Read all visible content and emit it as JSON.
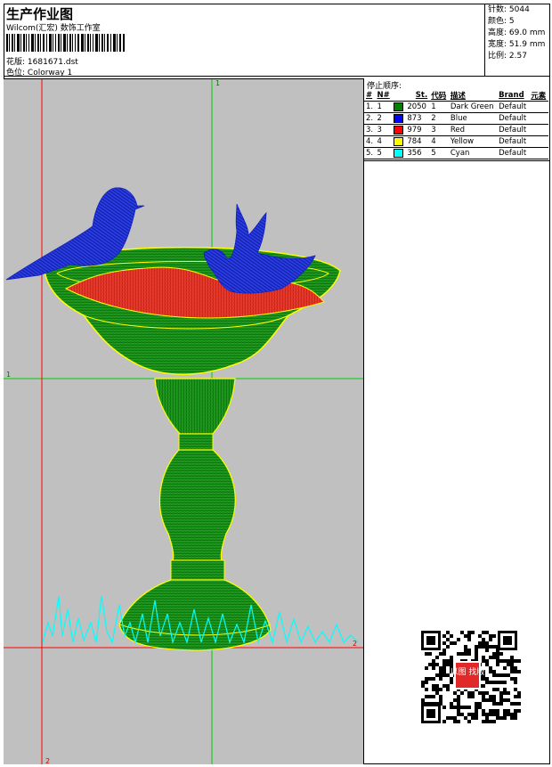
{
  "header": {
    "title": "生产作业图",
    "company": "Wilcom(汇宏) 数饰工作室",
    "design_label": "花版:",
    "design_value": "1681671.dst",
    "colorway_label": "色位:",
    "colorway_value": "Colorway 1"
  },
  "stats": [
    {
      "label": "针数:",
      "value": "5044"
    },
    {
      "label": "颜色:",
      "value": "5"
    },
    {
      "label": "高度:",
      "value": "69.0 mm"
    },
    {
      "label": "宽度:",
      "value": "51.9 mm"
    },
    {
      "label": "比例:",
      "value": "2.57"
    }
  ],
  "stop_sequence": {
    "label": "停止顺序:",
    "columns": [
      "#",
      "N#",
      "St.",
      "代码",
      "描述",
      "Brand",
      "元素"
    ],
    "rows": [
      {
        "num": "1.",
        "n": "1",
        "color": "#008000",
        "stitches": "2050",
        "code": "1",
        "desc": "Dark Green",
        "brand": "Default"
      },
      {
        "num": "2.",
        "n": "2",
        "color": "#0000ff",
        "stitches": "873",
        "code": "2",
        "desc": "Blue",
        "brand": "Default"
      },
      {
        "num": "3.",
        "n": "3",
        "color": "#ff0000",
        "stitches": "979",
        "code": "3",
        "desc": "Red",
        "brand": "Default"
      },
      {
        "num": "4.",
        "n": "4",
        "color": "#ffff00",
        "stitches": "784",
        "code": "4",
        "desc": "Yellow",
        "brand": "Default"
      },
      {
        "num": "5.",
        "n": "5",
        "color": "#00ffff",
        "stitches": "356",
        "code": "5",
        "desc": "Cyan",
        "brand": "Default"
      }
    ]
  },
  "canvas": {
    "background": "#c0c0c0",
    "guide_green": "#00cc00",
    "guide_red": "#ff0000",
    "markers": [
      "1",
      "1",
      "2",
      "2"
    ]
  },
  "qr": {
    "stamp_text": "以图 找版"
  }
}
